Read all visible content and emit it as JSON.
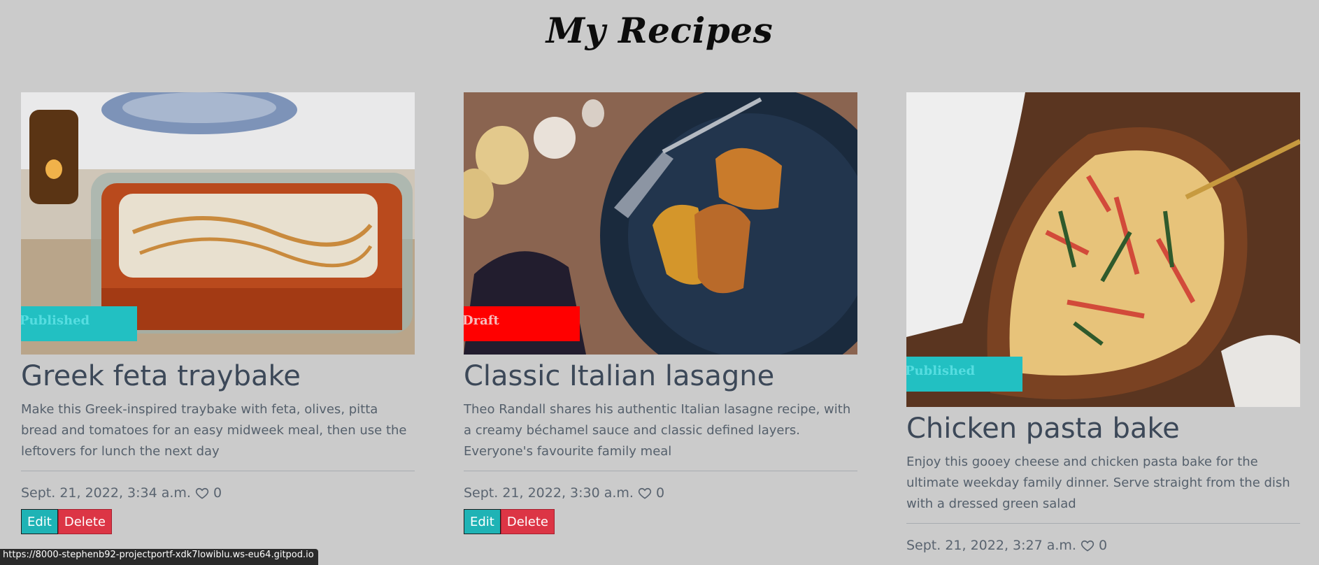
{
  "page": {
    "title": "My Recipes"
  },
  "recipes": [
    {
      "status": "Published",
      "title": "Greek feta traybake",
      "description": "Make this Greek-inspired traybake with feta, olives, pitta bread and tomatoes for an easy midweek meal, then use the leftovers for lunch the next day",
      "date": "Sept. 21, 2022, 3:34 a.m.",
      "likes": "0",
      "edit_label": "Edit",
      "delete_label": "Delete"
    },
    {
      "status": "Draft",
      "title": "Classic Italian lasagne",
      "description": "Theo Randall shares his authentic Italian lasagne recipe, with a creamy béchamel sauce and classic defined layers. Everyone's favourite family meal",
      "date": "Sept. 21, 2022, 3:30 a.m.",
      "likes": "0",
      "edit_label": "Edit",
      "delete_label": "Delete"
    },
    {
      "status": "Published",
      "title": "Chicken pasta bake",
      "description": "Enjoy this gooey cheese and chicken pasta bake for the ultimate weekday family dinner. Serve straight from the dish with a dressed green salad",
      "date": "Sept. 21, 2022, 3:27 a.m.",
      "likes": "0"
    }
  ],
  "status_bar": {
    "url": "https://8000-stephenb92-projectportf-xdk7lowiblu.ws-eu64.gitpod.io"
  },
  "colors": {
    "published": "#22c0c2",
    "draft": "#ff0000",
    "edit": "#1fb3b5",
    "delete": "#dc3545",
    "background": "#cbcbcb"
  }
}
